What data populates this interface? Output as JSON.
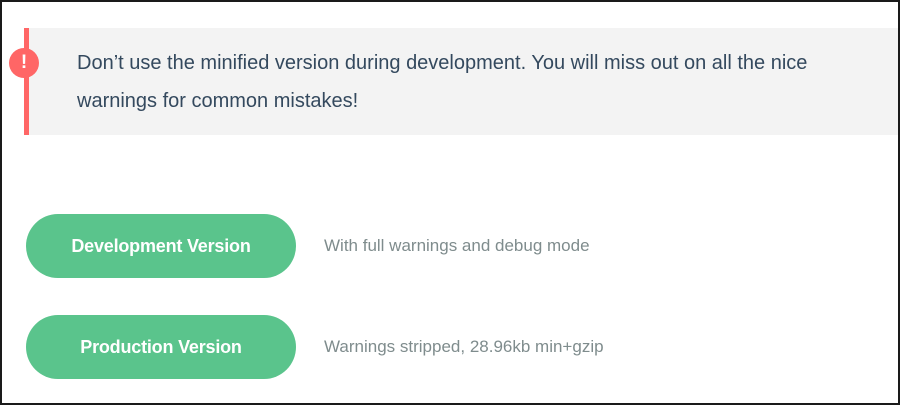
{
  "warning": {
    "icon": "!",
    "text": "Don’t use the minified version during development. You will miss out on all the nice warnings for common mistakes!"
  },
  "downloads": [
    {
      "button_label": "Development Version",
      "description": "With full warnings and debug mode"
    },
    {
      "button_label": "Production Version",
      "description": "Warnings stripped, 28.96kb min+gzip"
    }
  ],
  "colors": {
    "warning_accent": "#ff6666",
    "button_green": "#5ac48c",
    "warning_background": "#f3f3f3",
    "body_text": "#34495e",
    "description_text": "#7f8c8d"
  }
}
